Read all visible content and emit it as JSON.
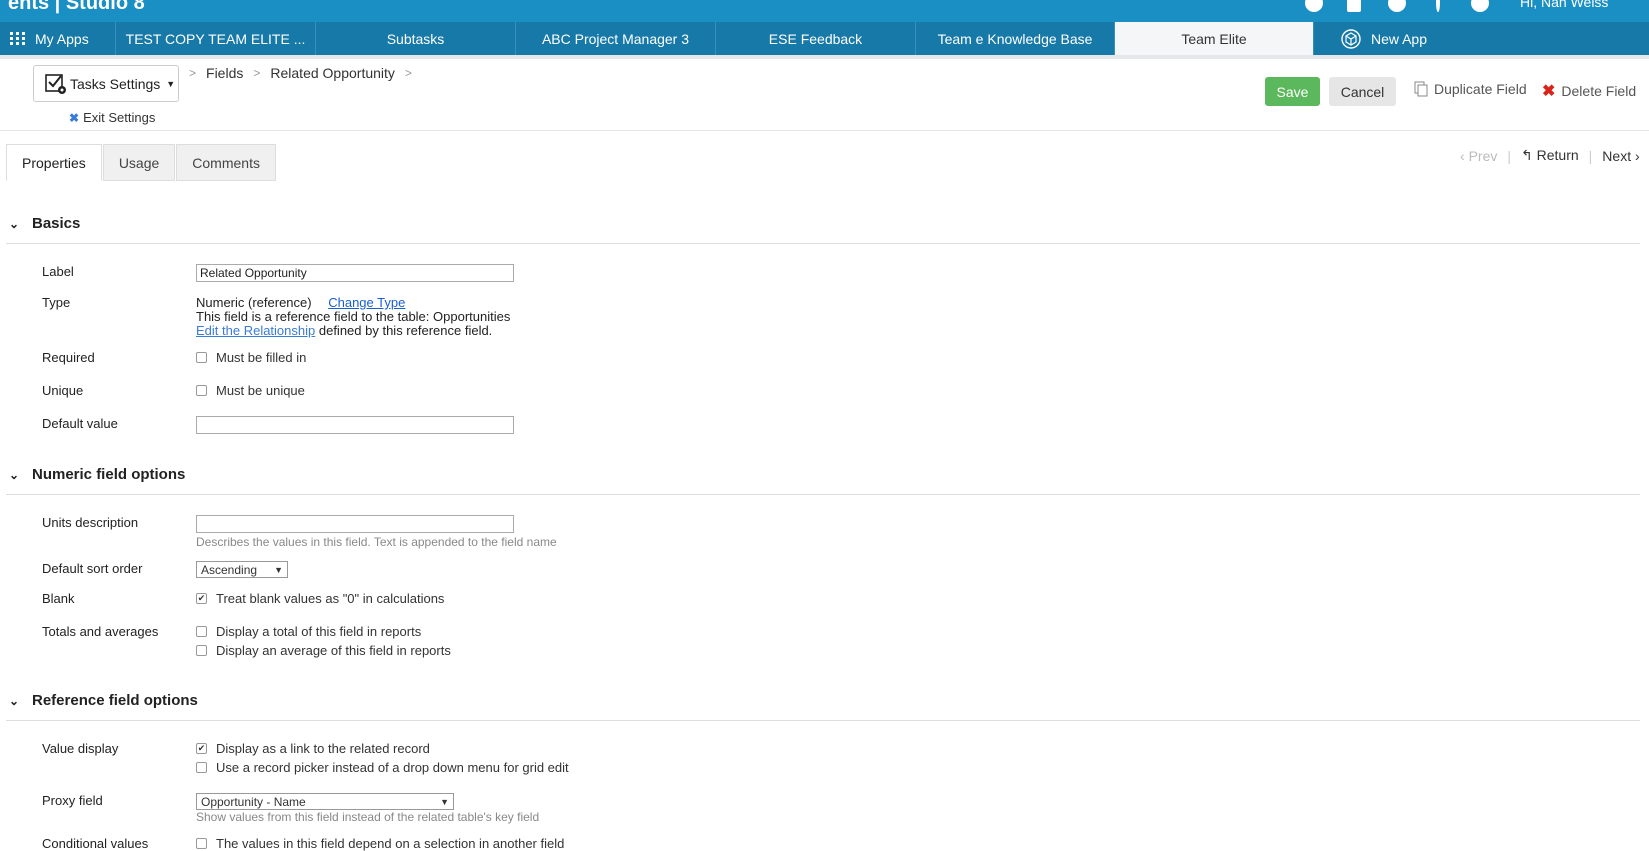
{
  "topbar": {
    "brand": "ents | Studio 8",
    "user": "Hi, Nan Weiss"
  },
  "app_tabs": [
    {
      "label": "My Apps"
    },
    {
      "label": "TEST COPY TEAM ELITE ..."
    },
    {
      "label": "Subtasks"
    },
    {
      "label": "ABC Project Manager 3"
    },
    {
      "label": "ESE Feedback"
    },
    {
      "label": "Team e Knowledge Base"
    },
    {
      "label": "Team Elite"
    },
    {
      "label": "New App"
    }
  ],
  "header": {
    "settings_label": "Tasks Settings",
    "exit_label": "Exit Settings",
    "breadcrumb": [
      "Fields",
      "Related Opportunity"
    ],
    "save": "Save",
    "cancel": "Cancel",
    "duplicate": "Duplicate Field",
    "delete": "Delete Field"
  },
  "page_tabs": [
    "Properties",
    "Usage",
    "Comments"
  ],
  "pager": {
    "prev": "Prev",
    "return": "Return",
    "next": "Next"
  },
  "basics": {
    "title": "Basics",
    "label_label": "Label",
    "label_value": "Related Opportunity",
    "type_label": "Type",
    "type_value": "Numeric (reference)",
    "change_type": "Change Type",
    "type_desc": "This field is a reference field to the table: Opportunities",
    "edit_rel_link": "Edit the Relationship",
    "edit_rel_rest": " defined by this reference field.",
    "required_label": "Required",
    "required_opt": "Must be filled in",
    "required_checked": false,
    "unique_label": "Unique",
    "unique_opt": "Must be unique",
    "unique_checked": false,
    "default_label": "Default value",
    "default_value": ""
  },
  "numeric": {
    "title": "Numeric field options",
    "units_label": "Units description",
    "units_value": "",
    "units_hint": "Describes the values in this field. Text is appended to the field name",
    "sort_label": "Default sort order",
    "sort_value": "Ascending",
    "blank_label": "Blank",
    "blank_opt": "Treat blank values as \"0\" in calculations",
    "blank_checked": true,
    "totals_label": "Totals and averages",
    "total_opt": "Display a total of this field in reports",
    "total_checked": false,
    "avg_opt": "Display an average of this field in reports",
    "avg_checked": false
  },
  "reference": {
    "title": "Reference field options",
    "value_display_label": "Value display",
    "link_opt": "Display as a link to the related record",
    "link_checked": true,
    "picker_opt": "Use a record picker instead of a drop down menu for grid edit",
    "picker_checked": false,
    "proxy_label": "Proxy field",
    "proxy_value": "Opportunity - Name",
    "proxy_hint": "Show values from this field instead of the related table's key field",
    "conditional_label": "Conditional values",
    "conditional_opt": "The values in this field depend on a selection in another field",
    "conditional_checked": false
  },
  "colors": {
    "brand": "#1a8fc4",
    "tabbar": "#1679a8",
    "save": "#5cb85c",
    "link": "#1a5fd1",
    "delete": "#d9241b"
  }
}
